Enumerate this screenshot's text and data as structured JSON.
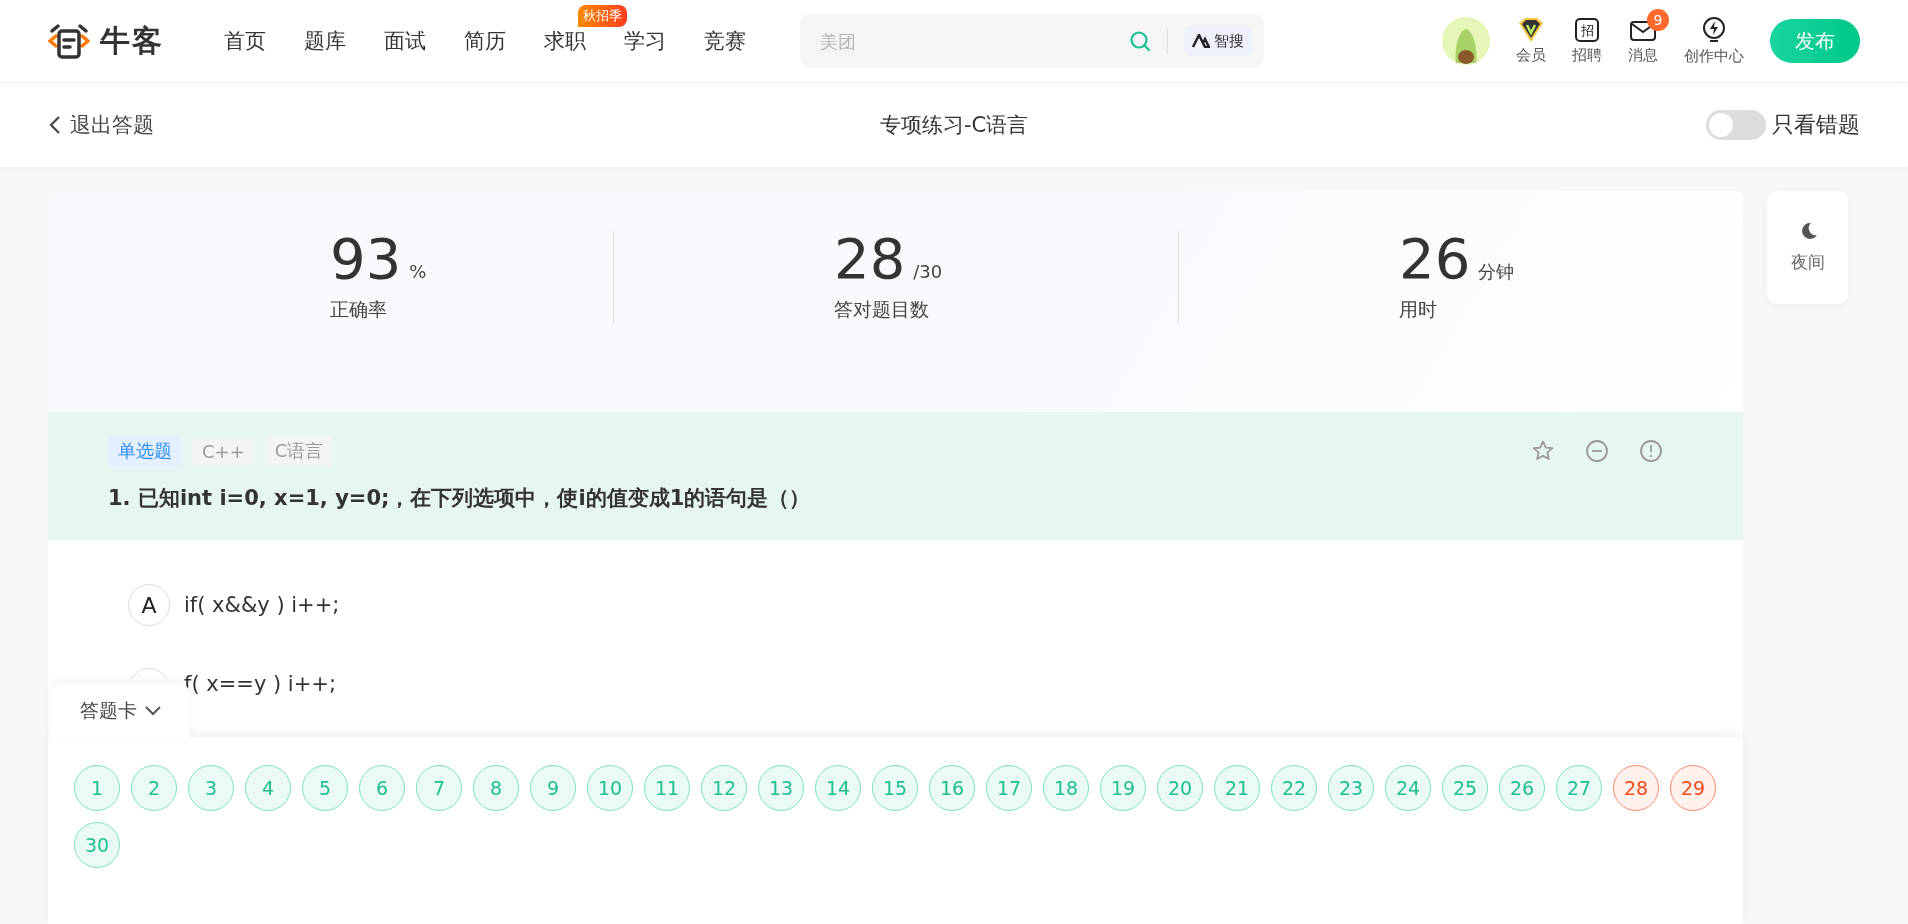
{
  "header": {
    "logo_text": "牛客",
    "nav": [
      {
        "label": "首页"
      },
      {
        "label": "题库"
      },
      {
        "label": "面试"
      },
      {
        "label": "简历"
      },
      {
        "label": "求职",
        "badge": "秋招季"
      },
      {
        "label": "学习"
      },
      {
        "label": "竞赛"
      }
    ],
    "search": {
      "placeholder": "美团",
      "ai_label": "智搜"
    },
    "tools": [
      {
        "kind": "vip",
        "label": "会员"
      },
      {
        "kind": "recruit",
        "label": "招聘",
        "icon_text": "招"
      },
      {
        "kind": "message",
        "label": "消息",
        "badge": "9"
      },
      {
        "kind": "create",
        "label": "创作中心"
      }
    ],
    "publish": "发布"
  },
  "subbar": {
    "back": "退出答题",
    "title": "专项练习-C语言",
    "toggle": {
      "label": "只看错题",
      "on": false
    }
  },
  "stats": [
    {
      "value": "93",
      "unit": "%",
      "label": "正确率"
    },
    {
      "value": "28",
      "unit": "/30",
      "label": "答对题目数"
    },
    {
      "value": "26",
      "unit": "分钟",
      "label": "用时"
    }
  ],
  "question": {
    "tags": [
      {
        "label": "单选题",
        "kind": "type"
      },
      {
        "label": "C++",
        "kind": "topic"
      },
      {
        "label": "C语言",
        "kind": "topic"
      }
    ],
    "text": "1. 已知int i=0, x=1, y=0;，在下列选项中，使i的值变成1的语句是（）",
    "options": [
      {
        "letter": "A",
        "text": "if( x&&y ) i++;"
      },
      {
        "text": "f( x==y ) i++;"
      }
    ]
  },
  "night": {
    "label": "夜间"
  },
  "answer_card": {
    "title": "答题卡",
    "items": [
      {
        "label": "1",
        "wrong": false
      },
      {
        "label": "2",
        "wrong": false
      },
      {
        "label": "3",
        "wrong": false
      },
      {
        "label": "4",
        "wrong": false
      },
      {
        "label": "5",
        "wrong": false
      },
      {
        "label": "6",
        "wrong": false
      },
      {
        "label": "7",
        "wrong": false
      },
      {
        "label": "8",
        "wrong": false
      },
      {
        "label": "9",
        "wrong": false
      },
      {
        "label": "10",
        "wrong": false
      },
      {
        "label": "11",
        "wrong": false
      },
      {
        "label": "12",
        "wrong": false
      },
      {
        "label": "13",
        "wrong": false
      },
      {
        "label": "14",
        "wrong": false
      },
      {
        "label": "15",
        "wrong": false
      },
      {
        "label": "16",
        "wrong": false
      },
      {
        "label": "17",
        "wrong": false
      },
      {
        "label": "18",
        "wrong": false
      },
      {
        "label": "19",
        "wrong": false
      },
      {
        "label": "20",
        "wrong": false
      },
      {
        "label": "21",
        "wrong": false
      },
      {
        "label": "22",
        "wrong": false
      },
      {
        "label": "23",
        "wrong": false
      },
      {
        "label": "24",
        "wrong": false
      },
      {
        "label": "25",
        "wrong": false
      },
      {
        "label": "26",
        "wrong": false
      },
      {
        "label": "27",
        "wrong": false
      },
      {
        "label": "28",
        "wrong": true
      },
      {
        "label": "29",
        "wrong": true
      },
      {
        "label": "30",
        "wrong": false
      }
    ]
  }
}
